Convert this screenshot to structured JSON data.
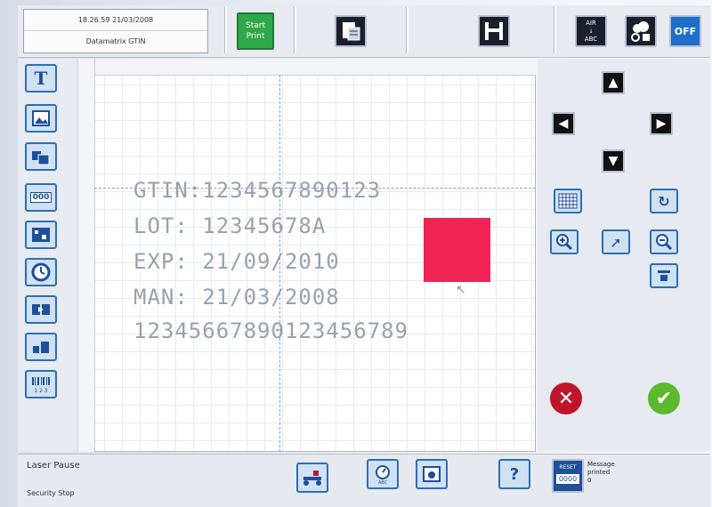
{
  "header": {
    "datetime": "18.26.59  21/03/2008",
    "message_name": "Datamatrix GTIN",
    "start_print_line1": "Start",
    "start_print_line2": "Print",
    "off_label": "OFF",
    "air_label_1": "AIR",
    "air_label_2": "ABC"
  },
  "canvas": {
    "lines": [
      "GTIN:1234567890123",
      "LOT: 12345678A",
      "EXP: 21/09/2010",
      "MAN: 21/03/2008",
      "12345667890123456789"
    ]
  },
  "footer": {
    "status1": "Laser Pause",
    "status2": "Security Stop",
    "reset_label": "RESET",
    "counter": "0000",
    "message_printed": "Message printed",
    "message_count": "0"
  },
  "colors": {
    "accent_blue": "#2d6fb3",
    "start_green": "#2fa84a",
    "red_object": "#ee2452",
    "cancel_red": "#c0142a",
    "ok_green": "#5cb82c"
  },
  "icons": {
    "left_tools": [
      "text-tool-icon",
      "image-tool-icon",
      "logo-tool-icon",
      "counter-tool-icon",
      "barcode-tool-icon",
      "clock-tool-icon",
      "shift-tool-icon",
      "move-tool-icon",
      "barcode123-tool-icon"
    ]
  }
}
